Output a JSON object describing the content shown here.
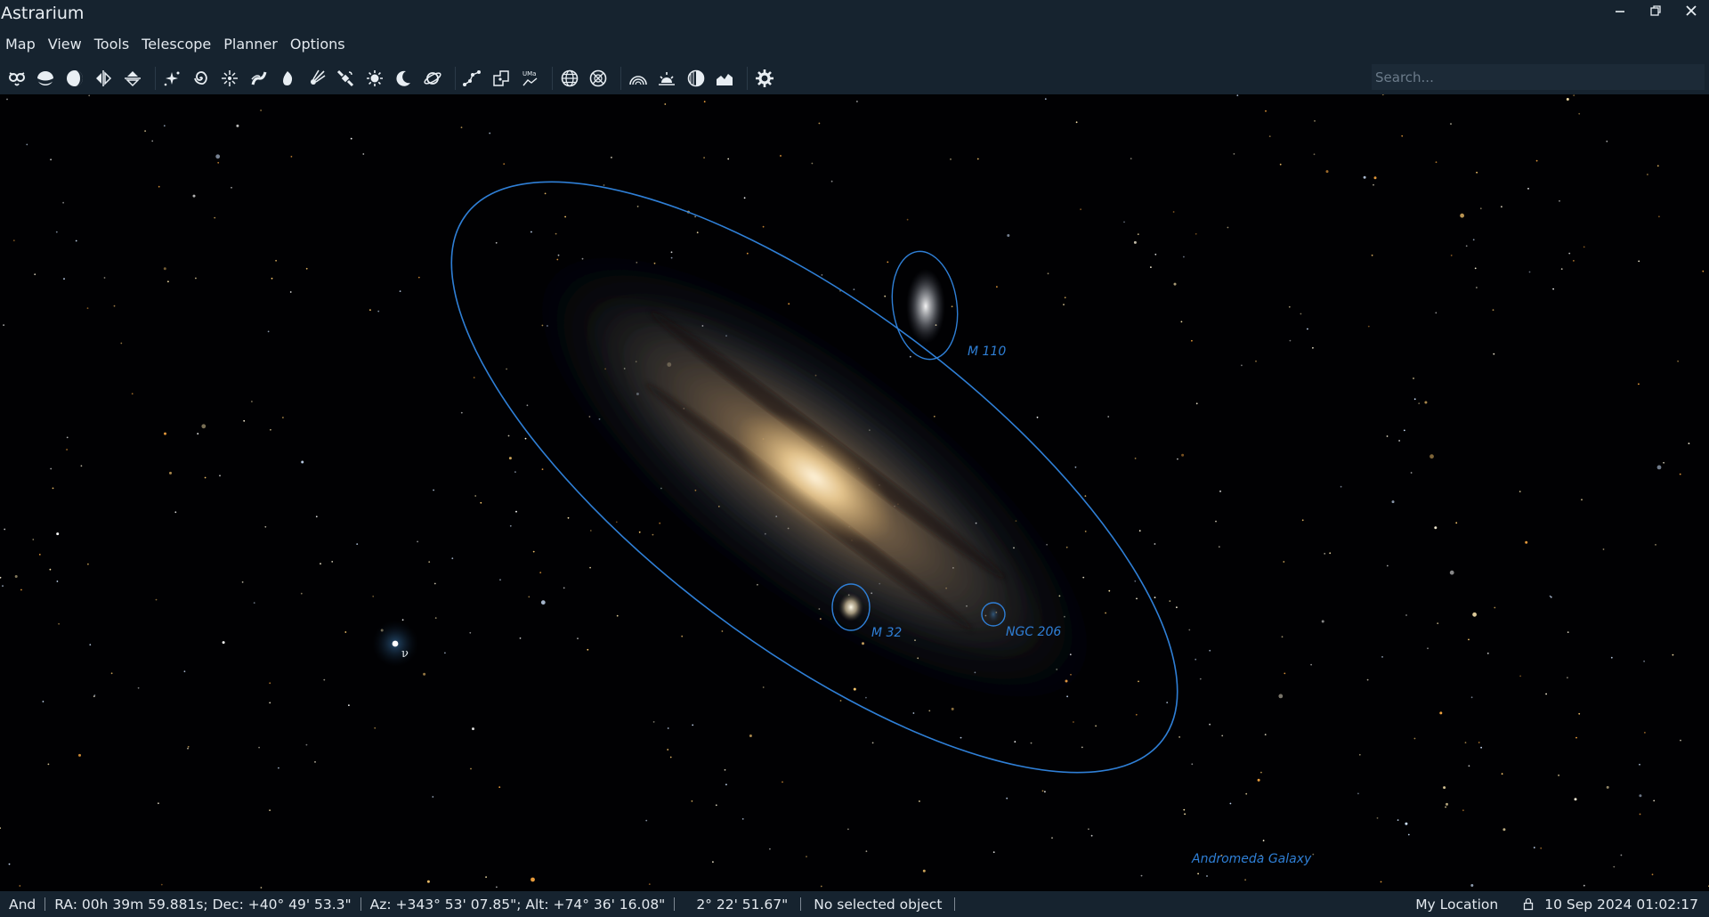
{
  "app": {
    "title": "Astrarium"
  },
  "window_controls": [
    {
      "name": "minimize-icon",
      "glyph": "–"
    },
    {
      "name": "restore-icon",
      "glyph": "⧉"
    },
    {
      "name": "close-icon",
      "glyph": "✕"
    }
  ],
  "menu": [
    "Map",
    "View",
    "Tools",
    "Telescope",
    "Planner",
    "Options"
  ],
  "toolbar": {
    "groups": [
      [
        "owl-icon",
        "ground-icon",
        "atmosphere-icon",
        "mirror-icon",
        "flip-icon"
      ],
      [
        "stars-icon",
        "galaxy-icon",
        "star-cluster-icon",
        "milky-way-icon",
        "nebula-icon",
        "comet-icon",
        "satellite-icon",
        "sun-icon",
        "moon-icon",
        "planet-icon"
      ],
      [
        "constellation-lines-icon",
        "constellation-borders-icon",
        "constellation-labels-icon"
      ],
      [
        "grid-globe-icon",
        "grid-horizontal-icon"
      ],
      [
        "horizon-icon",
        "sunrise-icon",
        "moon-phase-icon",
        "landscape-icon"
      ],
      [
        "settings-gear-icon"
      ]
    ]
  },
  "search": {
    "placeholder": "Search..."
  },
  "sky": {
    "objects": [
      {
        "label": "M 110"
      },
      {
        "label": "M 32"
      },
      {
        "label": "NGC 206"
      },
      {
        "label": "Andromeda Galaxy"
      }
    ],
    "star_labels": [
      {
        "label": "ν"
      }
    ],
    "colors": {
      "outline": "#2f7fd6",
      "background": "#010103"
    }
  },
  "status": {
    "constellation": "And",
    "radec": "RA: 00h 39m 59.881s; Dec: +40° 49' 53.3\"",
    "altaz": "Az: +343° 53' 07.85\"; Alt: +74° 36' 16.08\"",
    "fov": "2° 22' 51.67\"",
    "selected": "No selected object",
    "location": "My Location",
    "datetime": "10 Sep 2024 01:02:17"
  }
}
